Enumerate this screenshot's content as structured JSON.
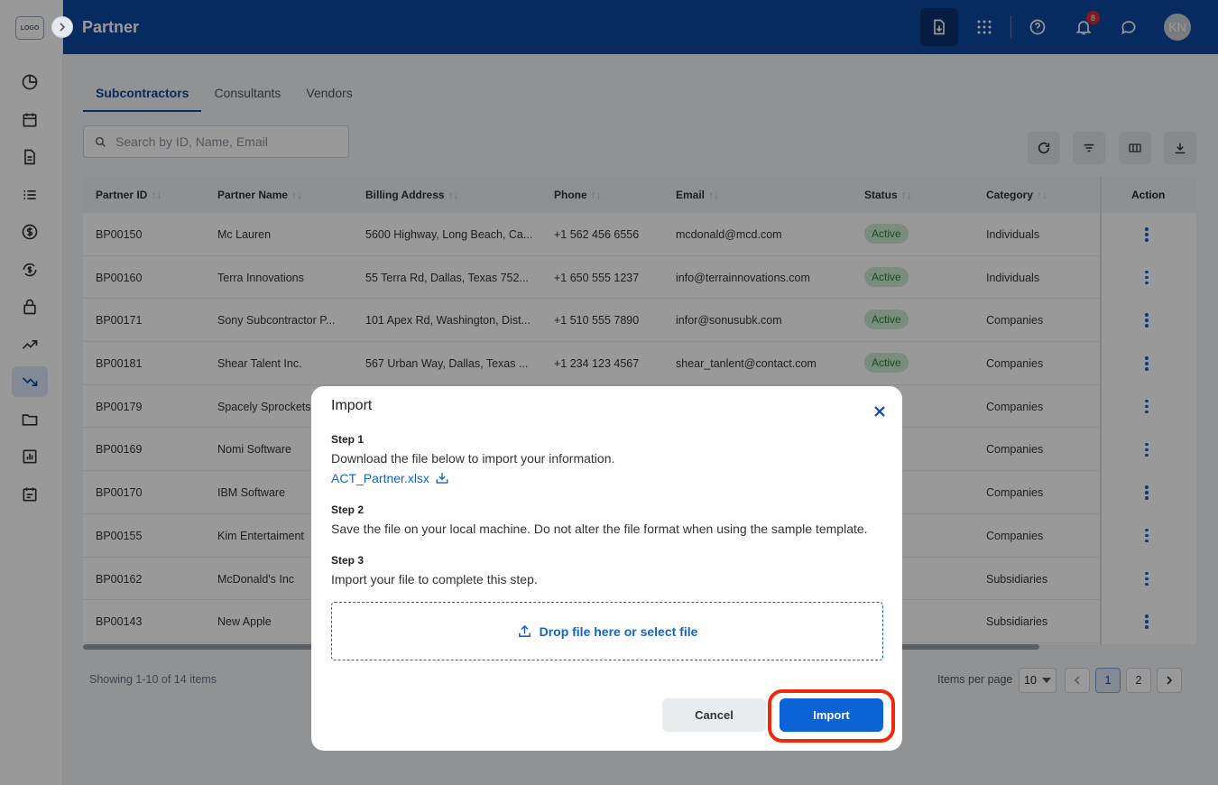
{
  "app": {
    "logo_text": "LOGO",
    "title": "Partner",
    "notification_count": "8",
    "user_initials": "KN"
  },
  "sidebar": {
    "items": [
      {
        "icon": "dashboard-icon"
      },
      {
        "icon": "calendar-icon"
      },
      {
        "icon": "document-icon"
      },
      {
        "icon": "list-icon"
      },
      {
        "icon": "dollar-icon"
      },
      {
        "icon": "currency-exchange-icon"
      },
      {
        "icon": "lock-icon"
      },
      {
        "icon": "trending-up-icon"
      },
      {
        "icon": "trending-down-icon",
        "active": true
      },
      {
        "icon": "folder-icon"
      },
      {
        "icon": "report-chart-icon"
      },
      {
        "icon": "schedule-icon"
      }
    ]
  },
  "tabs": [
    "Subcontractors",
    "Consultants",
    "Vendors"
  ],
  "search": {
    "placeholder": "Search by ID, Name, Email"
  },
  "table": {
    "columns": [
      "Partner ID",
      "Partner Name",
      "Billing Address",
      "Phone",
      "Email",
      "Status",
      "Category",
      "Action"
    ],
    "rows": [
      {
        "id": "BP00150",
        "name": "Mc Lauren",
        "address": "5600 Highway, Long Beach, Ca...",
        "phone": "+1 562 456 6556",
        "email": "mcdonald@mcd.com",
        "status": "Active",
        "category": "Individuals"
      },
      {
        "id": "BP00160",
        "name": "Terra Innovations",
        "address": "55 Terra Rd, Dallas, Texas 752...",
        "phone": "+1 650 555 1237",
        "email": "info@terrainnovations.com",
        "status": "Active",
        "category": "Individuals"
      },
      {
        "id": "BP00171",
        "name": "Sony Subcontractor P...",
        "address": "101 Apex Rd, Washington, Dist...",
        "phone": "+1 510 555 7890",
        "email": "infor@sonusubk.com",
        "status": "Active",
        "category": "Companies"
      },
      {
        "id": "BP00181",
        "name": "Shear Talent Inc.",
        "address": "567 Urban Way, Dallas, Texas ...",
        "phone": "+1 234 123 4567",
        "email": "shear_tanlent@contact.com",
        "status": "Active",
        "category": "Companies"
      },
      {
        "id": "BP00179",
        "name": "Spacely Sprockets",
        "address": "",
        "phone": "",
        "email": "",
        "status": "",
        "category": "Companies"
      },
      {
        "id": "BP00169",
        "name": "Nomi Software",
        "address": "",
        "phone": "",
        "email": "",
        "status": "",
        "category": "Companies"
      },
      {
        "id": "BP00170",
        "name": "IBM Software",
        "address": "",
        "phone": "",
        "email": "",
        "status": "",
        "category": "Companies"
      },
      {
        "id": "BP00155",
        "name": "Kim Entertaiment",
        "address": "",
        "phone": "",
        "email": "",
        "status": "",
        "category": "Companies"
      },
      {
        "id": "BP00162",
        "name": "McDonald's Inc",
        "address": "",
        "phone": "",
        "email": "",
        "status": "",
        "category": "Subsidiaries"
      },
      {
        "id": "BP00143",
        "name": "New Apple",
        "address": "",
        "phone": "",
        "email": "",
        "status": "",
        "category": "Subsidiaries"
      }
    ]
  },
  "pagination": {
    "showing": "Showing 1-10 of 14 items",
    "items_per_page_label": "Items per page",
    "items_per_page": "10",
    "pages": [
      "1",
      "2"
    ],
    "current": "1"
  },
  "modal": {
    "title": "Import",
    "step1_heading": "Step 1",
    "step1_text": "Download the file below to import your information.",
    "file_name": "ACT_Partner.xlsx",
    "step2_heading": "Step 2",
    "step2_text": "Save the file on your local machine. Do not alter the file format when using the sample template.",
    "step3_heading": "Step 3",
    "step3_text": "Import your file to complete this step.",
    "dropzone_text": "Drop file here or select file",
    "cancel_label": "Cancel",
    "import_label": "Import"
  },
  "colors": {
    "brand": "#0d47a1",
    "primary_button": "#0b63d6",
    "highlight": "#ee2a0c",
    "active_status": "#2e7d32"
  }
}
